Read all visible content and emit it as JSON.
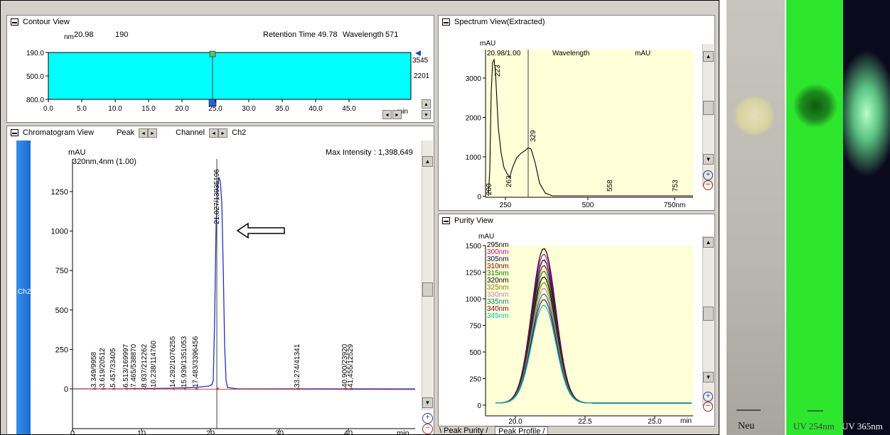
{
  "contour": {
    "title": "Contour View",
    "unit": "nm",
    "time_readout": "20.98",
    "wl_readout": "190",
    "rt_label": "Retention Time 49.78",
    "wl_label": "Wavelength",
    "wl_value": "571",
    "y_ticks": [
      "190.0",
      "500.0",
      "800.0"
    ],
    "x_ticks": [
      "0.0",
      "5.0",
      "10.0",
      "15.0",
      "20.0",
      "25.0",
      "30.0",
      "35.0",
      "40.0",
      "45.0"
    ],
    "x_unit": "min",
    "right_vals": [
      "3545",
      "2201"
    ],
    "fill_color": "#00ffff"
  },
  "chromatogram": {
    "title": "Chromatogram View",
    "peak_label": "Peak",
    "channel_label": "Channel",
    "channel_value": "Ch2",
    "side_tab": "Ch2",
    "unit": "mAU",
    "trace_label": "320nm,4nm (1.00)",
    "max_intensity": "Max Intensity : 1,398,649",
    "y_ticks": [
      "1250",
      "1000",
      "750",
      "500",
      "250",
      "0"
    ],
    "x_ticks": [
      "0",
      "10",
      "20",
      "30",
      "40"
    ],
    "x_unit": "min",
    "peak_labels": [
      "3.349/9958",
      "3.619/20512",
      "5.457/33405",
      "6.513/169997",
      "7.465/538870",
      "8.937/212262",
      "10.238/114760",
      "14.292/1076255",
      "15.939/1351053",
      "17.483/3396456",
      "21.027/13935196",
      "33.274/41341",
      "40.900/23920",
      "41.455/12529"
    ]
  },
  "spectrum": {
    "title": "Spectrum View(Extracted)",
    "unit": "mAU",
    "readout": "20.98/1.00",
    "col_wavelength": "Wavelength",
    "col_mau": "mAU",
    "y_ticks": [
      "3000",
      "2000",
      "1000",
      "0"
    ],
    "x_ticks": [
      "250",
      "500",
      "750nm"
    ],
    "peak_labels": [
      "200",
      "223",
      "263",
      "329",
      "558",
      "753"
    ]
  },
  "purity": {
    "title": "Purity View",
    "unit": "mAU",
    "y_ticks": [
      "1500",
      "1250",
      "1000",
      "750",
      "500",
      "250",
      "0"
    ],
    "x_ticks": [
      "20.0",
      "22.5",
      "25.0"
    ],
    "x_unit": "min",
    "legend": [
      {
        "label": "295nm",
        "color": "#000000"
      },
      {
        "label": "300nm",
        "color": "#c000c0"
      },
      {
        "label": "305nm",
        "color": "#000080"
      },
      {
        "label": "310nm",
        "color": "#800000"
      },
      {
        "label": "315nm",
        "color": "#008000"
      },
      {
        "label": "320nm",
        "color": "#000000"
      },
      {
        "label": "325nm",
        "color": "#808000"
      },
      {
        "label": "330nm",
        "color": "#c080c0"
      },
      {
        "label": "335nm",
        "color": "#008080"
      },
      {
        "label": "340nm",
        "color": "#800040"
      },
      {
        "label": "345nm",
        "color": "#00c0c0"
      }
    ],
    "tabs": [
      "Peak Purity",
      "Peak Profile"
    ]
  },
  "photos": {
    "labels": [
      "Neu",
      "UV 254nm",
      "UV 365nm"
    ]
  }
}
